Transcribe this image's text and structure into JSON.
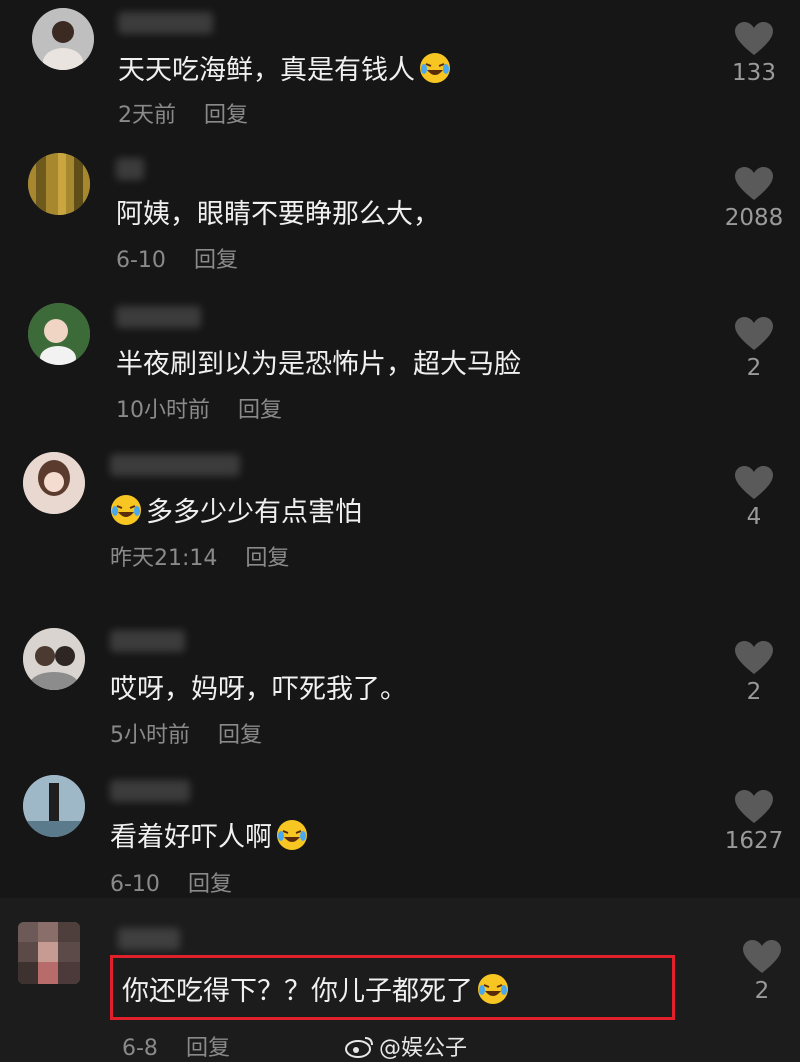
{
  "comments": [
    {
      "text": "天天吃海鲜，真是有钱人",
      "emoji_after": true,
      "time": "2天前",
      "reply": "回复",
      "likes": "133"
    },
    {
      "text": "阿姨，眼睛不要睁那么大，",
      "emoji_after": false,
      "time": "6-10",
      "reply": "回复",
      "likes": "2088"
    },
    {
      "text": "半夜刷到以为是恐怖片，超大马脸",
      "emoji_after": false,
      "time": "10小时前",
      "reply": "回复",
      "likes": "2"
    },
    {
      "text": "多多少少有点害怕",
      "emoji_before": true,
      "time": "昨天21:14",
      "reply": "回复",
      "likes": "4"
    },
    {
      "text": "哎呀，妈呀，吓死我了。",
      "emoji_after": false,
      "time": "5小时前",
      "reply": "回复",
      "likes": "2"
    },
    {
      "text": "看着好吓人啊",
      "emoji_after": true,
      "time": "6-10",
      "reply": "回复",
      "likes": "1627"
    },
    {
      "text": "你还吃得下？？你儿子都死了",
      "emoji_after": true,
      "time": "6-8",
      "reply": "回复",
      "likes": "2"
    }
  ],
  "watermark": "@娱公子",
  "colors": {
    "background": "#161616",
    "highlight_border": "#e0202a",
    "meta_text": "#8a8a8a"
  },
  "icons": {
    "like": "heart-icon",
    "emoji": "laughing-tears-emoji",
    "watermark": "weibo-logo"
  }
}
